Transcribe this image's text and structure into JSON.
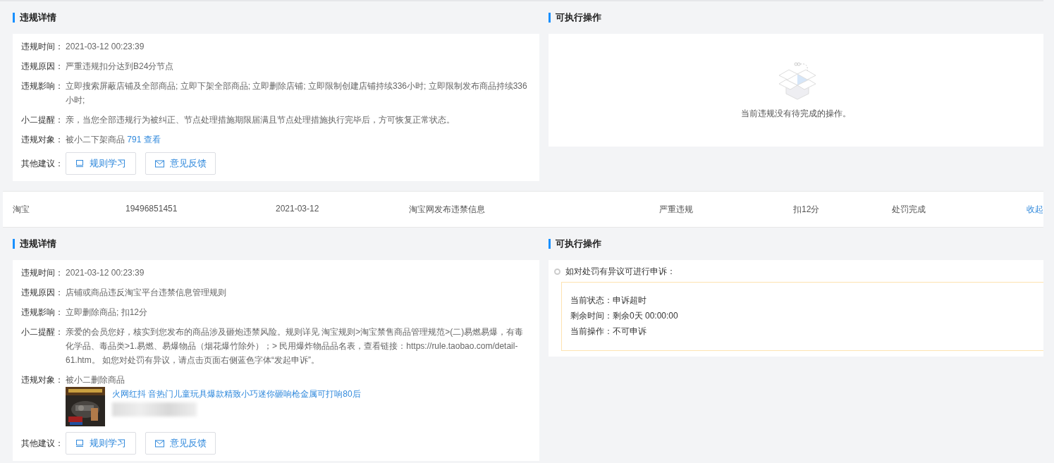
{
  "sections": [
    {
      "kind": "detail",
      "details": {
        "title": "违规详情",
        "fields": [
          {
            "label": "违规时间：",
            "value": "2021-03-12 00:23:39"
          },
          {
            "label": "违规原因：",
            "value": "严重违规扣分达到B24分节点"
          },
          {
            "label": "违规影响：",
            "value": "立即搜索屏蔽店铺及全部商品; 立即下架全部商品; 立即删除店铺; 立即限制创建店铺持续336小时; 立即限制发布商品持续336小时;"
          },
          {
            "label": "小二提醒：",
            "value": "亲，当您全部违规行为被纠正、节点处理措施期限届满且节点处理措施执行完毕后，方可恢复正常状态。"
          },
          {
            "label": "违规对象：",
            "value": "被小二下架商品",
            "link": "791 查看"
          }
        ],
        "suggestion": {
          "label": "其他建议：",
          "buttons": [
            {
              "label": "规则学习"
            },
            {
              "label": "意见反馈"
            }
          ]
        }
      },
      "actions": {
        "title": "可执行操作",
        "kind": "empty",
        "message": "当前违规没有待完成的操作。"
      }
    },
    {
      "kind": "record",
      "cells": [
        "淘宝",
        "19496851451",
        "2021-03-12",
        "淘宝网发布违禁信息",
        "严重违规",
        "扣12分",
        "处罚完成"
      ],
      "toggle": "收起"
    },
    {
      "kind": "detail",
      "details": {
        "title": "违规详情",
        "fields": [
          {
            "label": "违规时间：",
            "value": "2021-03-12 00:23:39"
          },
          {
            "label": "违规原因：",
            "value": "店铺或商品违反淘宝平台违禁信息管理规则"
          },
          {
            "label": "违规影响：",
            "value": "立即删除商品; 扣12分"
          },
          {
            "label": "小二提醒：",
            "value": "亲爱的会员您好，核实到您发布的商品涉及砸炮违禁风险。规则详见 淘宝规则>淘宝禁售商品管理规范>(二)易燃易爆，有毒化学品、毒品类>1.易燃、易爆物品（烟花爆竹除外）；> 民用爆炸物品品名表，查看链接：https://rule.taobao.com/detail-61.htm。 如您对处罚有异议，请点击页面右侧蓝色字体“发起申诉”。"
          },
          {
            "label": "违规对象：",
            "value": "被小二删除商品",
            "product": {
              "kind": "picture",
              "title": "火网红抖 音热门儿童玩具爆款精致小巧迷你砸响枪金属可打响80后"
            }
          }
        ],
        "suggestion": {
          "label": "其他建议：",
          "buttons": [
            {
              "label": "规则学习"
            },
            {
              "label": "意见反馈"
            }
          ]
        }
      },
      "actions": {
        "title": "可执行操作",
        "kind": "appeal",
        "message": "如对处罚有异议可进行申诉：",
        "statuses": [
          {
            "label": "当前状态：",
            "value": "申诉超时"
          },
          {
            "label": "剩余时间：",
            "value": "剩余0天 00:00:00"
          },
          {
            "label": "当前操作：",
            "value": "不可申诉"
          }
        ]
      }
    }
  ]
}
